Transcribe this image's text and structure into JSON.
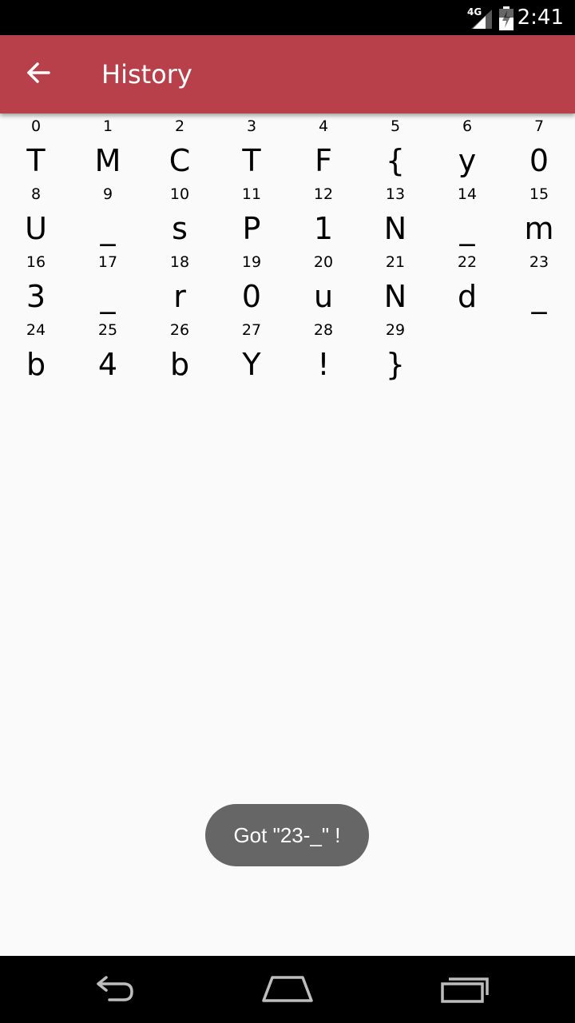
{
  "status_bar": {
    "network_label": "4G",
    "time": "2:41"
  },
  "app_bar": {
    "title": "History",
    "back_icon": "arrow-back-icon",
    "color": "#b8404a"
  },
  "history": [
    {
      "index": "0",
      "char": "T"
    },
    {
      "index": "1",
      "char": "M"
    },
    {
      "index": "2",
      "char": "C"
    },
    {
      "index": "3",
      "char": "T"
    },
    {
      "index": "4",
      "char": "F"
    },
    {
      "index": "5",
      "char": "{"
    },
    {
      "index": "6",
      "char": "y"
    },
    {
      "index": "7",
      "char": "0"
    },
    {
      "index": "8",
      "char": "U"
    },
    {
      "index": "9",
      "char": "_"
    },
    {
      "index": "10",
      "char": "s"
    },
    {
      "index": "11",
      "char": "P"
    },
    {
      "index": "12",
      "char": "1"
    },
    {
      "index": "13",
      "char": "N"
    },
    {
      "index": "14",
      "char": "_"
    },
    {
      "index": "15",
      "char": "m"
    },
    {
      "index": "16",
      "char": "3"
    },
    {
      "index": "17",
      "char": "_"
    },
    {
      "index": "18",
      "char": "r"
    },
    {
      "index": "19",
      "char": "0"
    },
    {
      "index": "20",
      "char": "u"
    },
    {
      "index": "21",
      "char": "N"
    },
    {
      "index": "22",
      "char": "d"
    },
    {
      "index": "23",
      "char": "_"
    },
    {
      "index": "24",
      "char": "b"
    },
    {
      "index": "25",
      "char": "4"
    },
    {
      "index": "26",
      "char": "b"
    },
    {
      "index": "27",
      "char": "Y"
    },
    {
      "index": "28",
      "char": "!"
    },
    {
      "index": "29",
      "char": "}"
    }
  ],
  "toast": {
    "message": "Got \"23-_\" !"
  },
  "nav_bar": {
    "back_icon": "nav-back-icon",
    "home_icon": "nav-home-icon",
    "recents_icon": "nav-recents-icon"
  }
}
